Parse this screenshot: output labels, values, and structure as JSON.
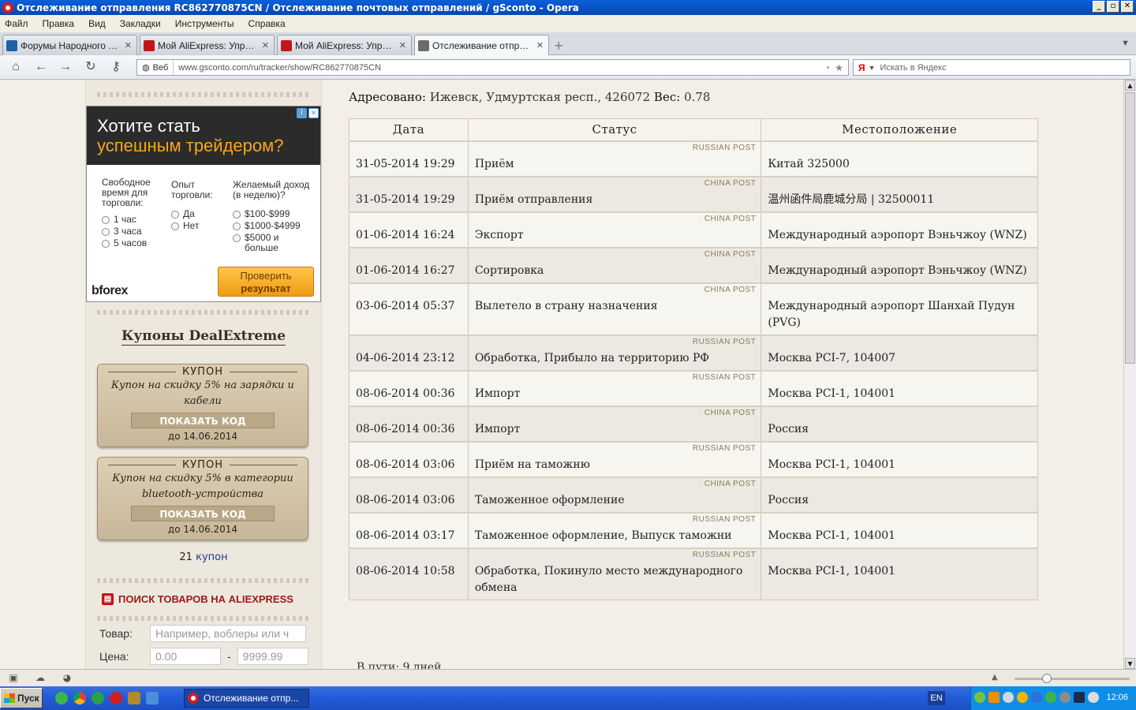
{
  "window": {
    "title": "Отслеживание отправления RC862770875CN / Отслеживание почтовых отправлений / gSconto - Opera"
  },
  "menu": [
    "Файл",
    "Правка",
    "Вид",
    "Закладки",
    "Инструменты",
    "Справка"
  ],
  "tabs": [
    {
      "label": "Форумы Народного Инт…",
      "fav_color": "#1f5fa8"
    },
    {
      "label": "Мой AliExpress: Управл…",
      "fav_color": "#c0161a"
    },
    {
      "label": "Мой AliExpress: Управл…",
      "fav_color": "#c0161a"
    },
    {
      "label": "Отслеживание отправл…",
      "fav_color": "#6b6b6b"
    }
  ],
  "address_bar": {
    "badge": "Веб",
    "url": "www.gsconto.com/ru/tracker/show/RC862770875CN"
  },
  "search": {
    "engine": "Я",
    "placeholder": "Искать в Яндекс"
  },
  "ad": {
    "headline_1": "Хотите стать",
    "headline_2": "успешным трейдером?",
    "q1": "Свободное время для торговли:",
    "q1_options": [
      "1 час",
      "3 часа",
      "5 часов"
    ],
    "q2": "Опыт торговли:",
    "q2_options": [
      "Да",
      "Нет"
    ],
    "q3": "Желаемый доход (в неделю)?",
    "q3_options": [
      "$100-$999",
      "$1000-$4999",
      "$5000 и больше"
    ],
    "button_1": "Проверить",
    "button_2": "результат",
    "logo": "bforex"
  },
  "coupons": {
    "title": "Купоны DealExtreme",
    "items": [
      {
        "head": "КУПОН",
        "text": "Купон на скидку 5% на зарядки и кабели",
        "button": "ПОКАЗАТЬ КОД",
        "date": "до 14.06.2014"
      },
      {
        "head": "КУПОН",
        "text": "Купон на скидку 5% в категории bluetooth-устройства",
        "button": "ПОКАЗАТЬ КОД",
        "date": "до 14.06.2014"
      }
    ],
    "count_num": "21",
    "count_label": "купон"
  },
  "ali_search": {
    "title": "ПОИСК ТОВАРОВ НА ALIEXPRESS",
    "product_label": "Товар:",
    "product_placeholder": "Например, воблеры или ч",
    "price_label": "Цена:",
    "price_from": "0.00",
    "price_sep": "-",
    "price_to": "9999.99"
  },
  "shipment": {
    "addressed_label": "Адресовано:",
    "addressed_value": "Ижевск, Удмуртская респ., 426072",
    "weight_label": "Вес:",
    "weight_value": "0.78",
    "in_transit": "В пути: 9 дней"
  },
  "table": {
    "headers": [
      "Дата",
      "Статус",
      "Местоположение"
    ],
    "rows": [
      {
        "date": "31-05-2014 19:29",
        "status": "Приём",
        "location": "Китай 325000",
        "source": "RUSSIAN POST"
      },
      {
        "date": "31-05-2014 19:29",
        "status": "Приём отправления",
        "location": "温州函件局鹿城分局 | 32500011",
        "source": "CHINA POST"
      },
      {
        "date": "01-06-2014 16:24",
        "status": "Экспорт",
        "location": "Международный аэропорт Вэньчжоу (WNZ)",
        "source": "CHINA POST"
      },
      {
        "date": "01-06-2014 16:27",
        "status": "Сортировка",
        "location": "Международный аэропорт Вэньчжоу (WNZ)",
        "source": "CHINA POST"
      },
      {
        "date": "03-06-2014 05:37",
        "status": "Вылетело в страну назначения",
        "location": "Международный аэропорт Шанхай Пудун (PVG)",
        "source": "CHINA POST"
      },
      {
        "date": "04-06-2014 23:12",
        "status": "Обработка, Прибыло на территорию РФ",
        "location": "Москва PCI-7, 104007",
        "source": "RUSSIAN POST"
      },
      {
        "date": "08-06-2014 00:36",
        "status": "Импорт",
        "location": "Москва PCI-1, 104001",
        "source": "RUSSIAN POST"
      },
      {
        "date": "08-06-2014 00:36",
        "status": "Импорт",
        "location": "Россия",
        "source": "CHINA POST"
      },
      {
        "date": "08-06-2014 03:06",
        "status": "Приём на таможню",
        "location": "Москва PCI-1, 104001",
        "source": "RUSSIAN POST"
      },
      {
        "date": "08-06-2014 03:06",
        "status": "Таможенное оформление",
        "location": "Россия",
        "source": "CHINA POST"
      },
      {
        "date": "08-06-2014 03:17",
        "status": "Таможенное оформление, Выпуск таможни",
        "location": "Москва PCI-1, 104001",
        "source": "RUSSIAN POST"
      },
      {
        "date": "08-06-2014 10:58",
        "status": "Обработка, Покинуло место международного обмена",
        "location": "Москва PCI-1, 104001",
        "source": "RUSSIAN POST"
      }
    ]
  },
  "taskbar": {
    "start": "Пуск",
    "active_task": "Отслеживание отпр...",
    "lang": "EN",
    "clock": "12:06"
  }
}
